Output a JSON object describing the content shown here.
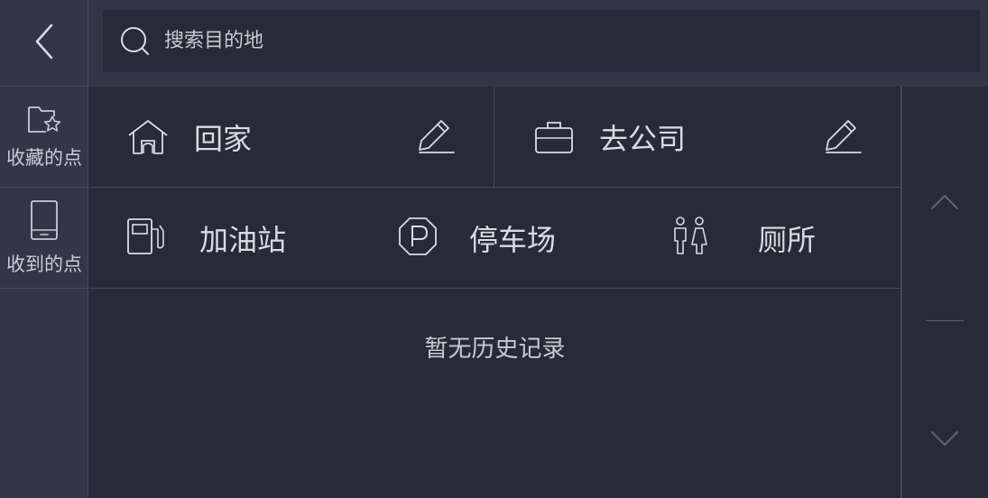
{
  "search": {
    "placeholder": "搜索目的地"
  },
  "sidebar": {
    "favorites_label": "收藏的点",
    "received_label": "收到的点"
  },
  "quick": {
    "home_label": "回家",
    "work_label": "去公司"
  },
  "categories": {
    "gas": "加油站",
    "parking": "停车场",
    "toilet": "厕所"
  },
  "history": {
    "empty_text": "暂无历史记录"
  },
  "icons": {
    "back": "chevron-left-icon",
    "search": "search-icon",
    "favorites": "star-folder-icon",
    "received": "phone-icon",
    "home": "home-icon",
    "work": "briefcase-icon",
    "edit": "pencil-icon",
    "gas": "gas-pump-icon",
    "parking": "parking-icon",
    "toilet": "restroom-icon",
    "scroll_up": "chevron-up-icon",
    "scroll_down": "chevron-down-icon"
  },
  "colors": {
    "background": "#272b37",
    "panel": "#313746",
    "divider": "#454b59",
    "text": "#d9dce3"
  }
}
